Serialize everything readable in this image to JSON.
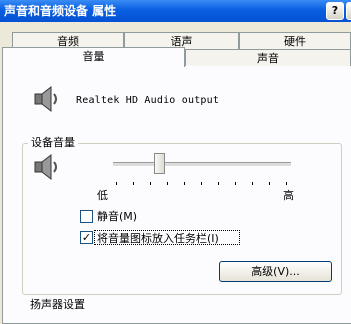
{
  "window": {
    "title": "声音和音频设备 属性",
    "help_glyph": "?",
    "close_glyph": "✕"
  },
  "tabs_top": [
    {
      "label": "音频"
    },
    {
      "label": "语声"
    },
    {
      "label": "硬件"
    }
  ],
  "tabs_bottom": [
    {
      "label": "音量"
    },
    {
      "label": "声音"
    }
  ],
  "device": {
    "name": "Realtek HD Audio output",
    "icon": "speaker-icon"
  },
  "device_volume": {
    "group_label": "设备音量",
    "icon": "speaker-icon",
    "low_label": "低",
    "high_label": "高",
    "level_fraction": 0.27
  },
  "mute": {
    "label": "静音(M)",
    "checked": false
  },
  "taskbar_icon": {
    "label": "将音量图标放入任务栏(I)",
    "checked": true,
    "check_glyph": "✓"
  },
  "advanced_button": {
    "label": "高级(V)..."
  },
  "speaker_settings": {
    "label": "扬声器设置"
  }
}
